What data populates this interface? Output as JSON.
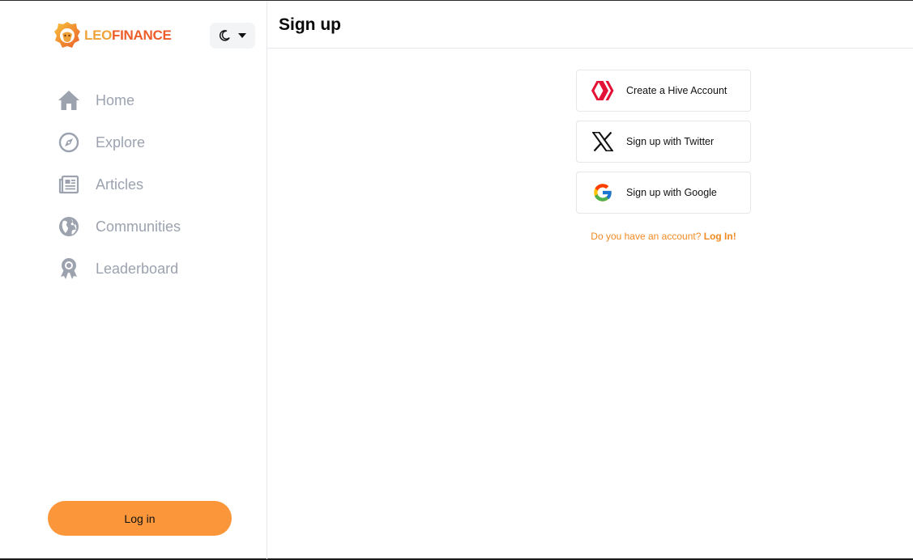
{
  "brand": {
    "name_part1": "LEO",
    "name_part2": "FINANCE",
    "colors": {
      "leo": "#f0a23a",
      "finance": "#ec5d2a"
    }
  },
  "theme_toggle": {
    "icon": "moon-icon",
    "dropdown_icon": "caret-down-icon"
  },
  "sidebar": {
    "items": [
      {
        "label": "Home",
        "icon": "home-icon"
      },
      {
        "label": "Explore",
        "icon": "compass-icon"
      },
      {
        "label": "Articles",
        "icon": "newspaper-icon"
      },
      {
        "label": "Communities",
        "icon": "globe-icon"
      },
      {
        "label": "Leaderboard",
        "icon": "award-icon"
      }
    ],
    "login_label": "Log in"
  },
  "main": {
    "title": "Sign up",
    "options": [
      {
        "label": "Create a Hive Account",
        "icon": "hive-icon"
      },
      {
        "label": "Sign up with Twitter",
        "icon": "x-twitter-icon"
      },
      {
        "label": "Sign up with Google",
        "icon": "google-icon"
      }
    ],
    "account_prompt": "Do you have an account?",
    "login_link": "Log In!"
  },
  "colors": {
    "accent": "#fb963b",
    "link": "#f08a24",
    "nav_text": "#9ca3af",
    "nav_icon": "#9ca3af",
    "hive_red": "#e31337"
  }
}
